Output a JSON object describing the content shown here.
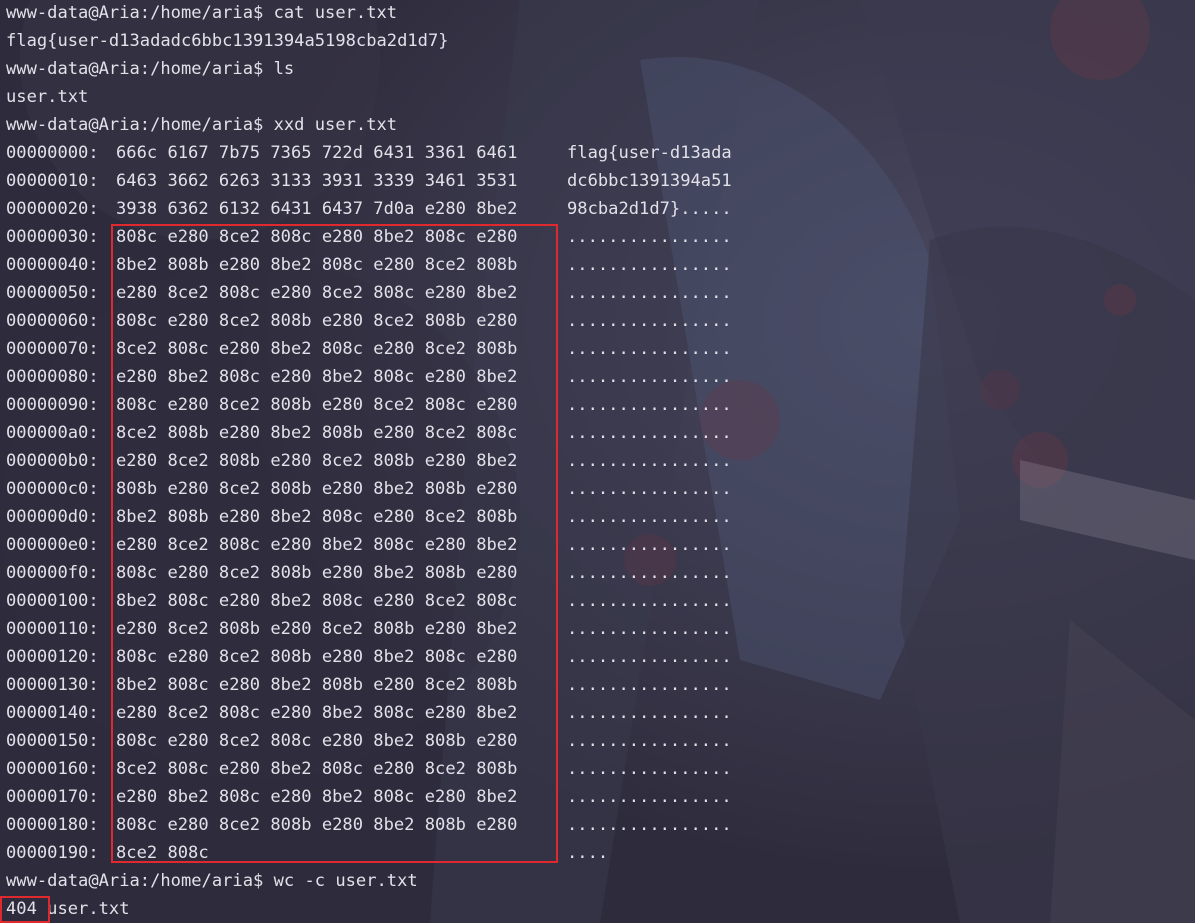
{
  "theme": {
    "background": "#2e2c3c",
    "foreground": "#e2e0e8",
    "highlight": "#e0282f"
  },
  "terminal": {
    "lines_before": [
      "www-data@Aria:/home/aria$ cat user.txt",
      "flag{user-d13adadc6bbc1391394a5198cba2d1d7}",
      "www-data@Aria:/home/aria$ ls",
      "user.txt",
      "www-data@Aria:/home/aria$ xxd user.txt"
    ],
    "xxd_rows": [
      {
        "offset": "00000000:",
        "hex": "666c 6167 7b75 7365 722d 6431 3361 6461",
        "ascii": "flag{user-d13ada"
      },
      {
        "offset": "00000010:",
        "hex": "6463 3662 6263 3133 3931 3339 3461 3531",
        "ascii": "dc6bbc1391394a51"
      },
      {
        "offset": "00000020:",
        "hex": "3938 6362 6132 6431 6437 7d0a e280 8be2",
        "ascii": "98cba2d1d7}....."
      },
      {
        "offset": "00000030:",
        "hex": "808c e280 8ce2 808c e280 8be2 808c e280",
        "ascii": "................"
      },
      {
        "offset": "00000040:",
        "hex": "8be2 808b e280 8be2 808c e280 8ce2 808b",
        "ascii": "................"
      },
      {
        "offset": "00000050:",
        "hex": "e280 8ce2 808c e280 8ce2 808c e280 8be2",
        "ascii": "................"
      },
      {
        "offset": "00000060:",
        "hex": "808c e280 8ce2 808b e280 8ce2 808b e280",
        "ascii": "................"
      },
      {
        "offset": "00000070:",
        "hex": "8ce2 808c e280 8be2 808c e280 8ce2 808b",
        "ascii": "................"
      },
      {
        "offset": "00000080:",
        "hex": "e280 8be2 808c e280 8be2 808c e280 8be2",
        "ascii": "................"
      },
      {
        "offset": "00000090:",
        "hex": "808c e280 8ce2 808b e280 8ce2 808c e280",
        "ascii": "................"
      },
      {
        "offset": "000000a0:",
        "hex": "8ce2 808b e280 8be2 808b e280 8ce2 808c",
        "ascii": "................"
      },
      {
        "offset": "000000b0:",
        "hex": "e280 8ce2 808b e280 8ce2 808b e280 8be2",
        "ascii": "................"
      },
      {
        "offset": "000000c0:",
        "hex": "808b e280 8ce2 808b e280 8be2 808b e280",
        "ascii": "................"
      },
      {
        "offset": "000000d0:",
        "hex": "8be2 808b e280 8be2 808c e280 8ce2 808b",
        "ascii": "................"
      },
      {
        "offset": "000000e0:",
        "hex": "e280 8ce2 808c e280 8be2 808c e280 8be2",
        "ascii": "................"
      },
      {
        "offset": "000000f0:",
        "hex": "808c e280 8ce2 808b e280 8be2 808b e280",
        "ascii": "................"
      },
      {
        "offset": "00000100:",
        "hex": "8be2 808c e280 8be2 808c e280 8ce2 808c",
        "ascii": "................"
      },
      {
        "offset": "00000110:",
        "hex": "e280 8ce2 808b e280 8ce2 808b e280 8be2",
        "ascii": "................"
      },
      {
        "offset": "00000120:",
        "hex": "808c e280 8ce2 808b e280 8be2 808c e280",
        "ascii": "................"
      },
      {
        "offset": "00000130:",
        "hex": "8be2 808c e280 8be2 808b e280 8ce2 808b",
        "ascii": "................"
      },
      {
        "offset": "00000140:",
        "hex": "e280 8ce2 808c e280 8be2 808c e280 8be2",
        "ascii": "................"
      },
      {
        "offset": "00000150:",
        "hex": "808c e280 8ce2 808c e280 8be2 808b e280",
        "ascii": "................"
      },
      {
        "offset": "00000160:",
        "hex": "8ce2 808c e280 8be2 808c e280 8ce2 808b",
        "ascii": "................"
      },
      {
        "offset": "00000170:",
        "hex": "e280 8be2 808c e280 8be2 808c e280 8be2",
        "ascii": "................"
      },
      {
        "offset": "00000180:",
        "hex": "808c e280 8ce2 808b e280 8be2 808b e280",
        "ascii": "................"
      },
      {
        "offset": "00000190:",
        "hex": "8ce2 808c",
        "ascii": "...."
      }
    ],
    "lines_after": [
      "www-data@Aria:/home/aria$ wc -c user.txt"
    ],
    "wc_result": {
      "count": "404",
      "file": "user.txt"
    }
  }
}
